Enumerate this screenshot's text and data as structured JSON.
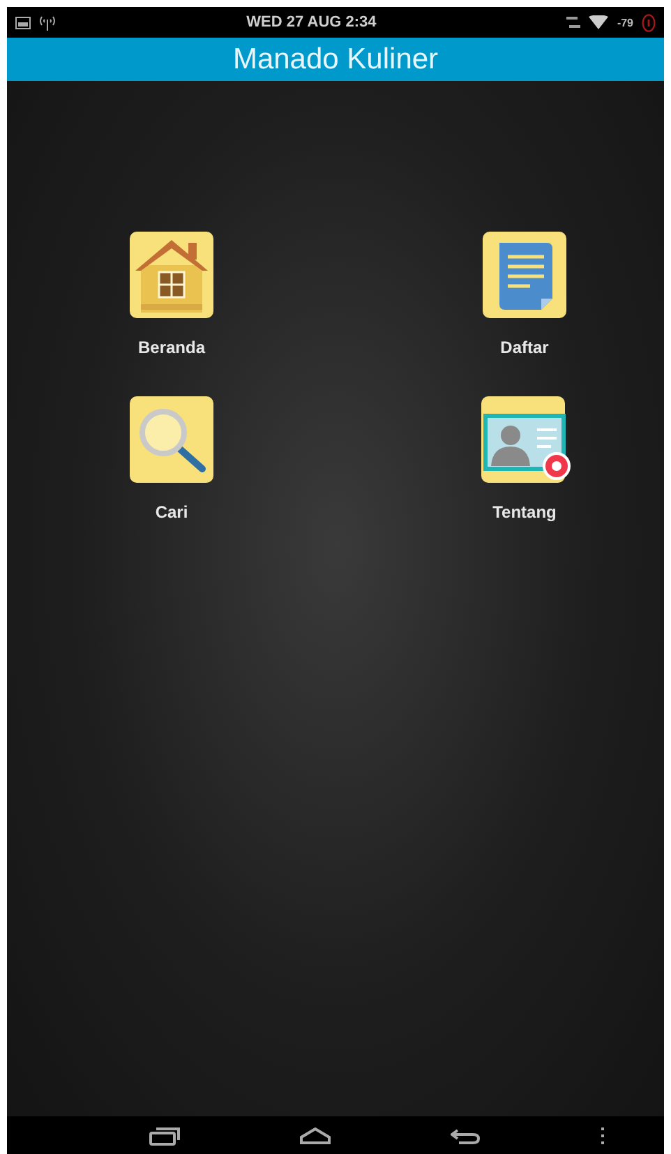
{
  "status_bar": {
    "time": "WED 27 AUG 2:34",
    "signal_reading": "-79"
  },
  "app_bar": {
    "title": "Manado Kuliner"
  },
  "menu": [
    {
      "kind": "home",
      "label": "Beranda"
    },
    {
      "kind": "list",
      "label": "Daftar"
    },
    {
      "kind": "search",
      "label": "Cari"
    },
    {
      "kind": "about",
      "label": "Tentang"
    }
  ]
}
